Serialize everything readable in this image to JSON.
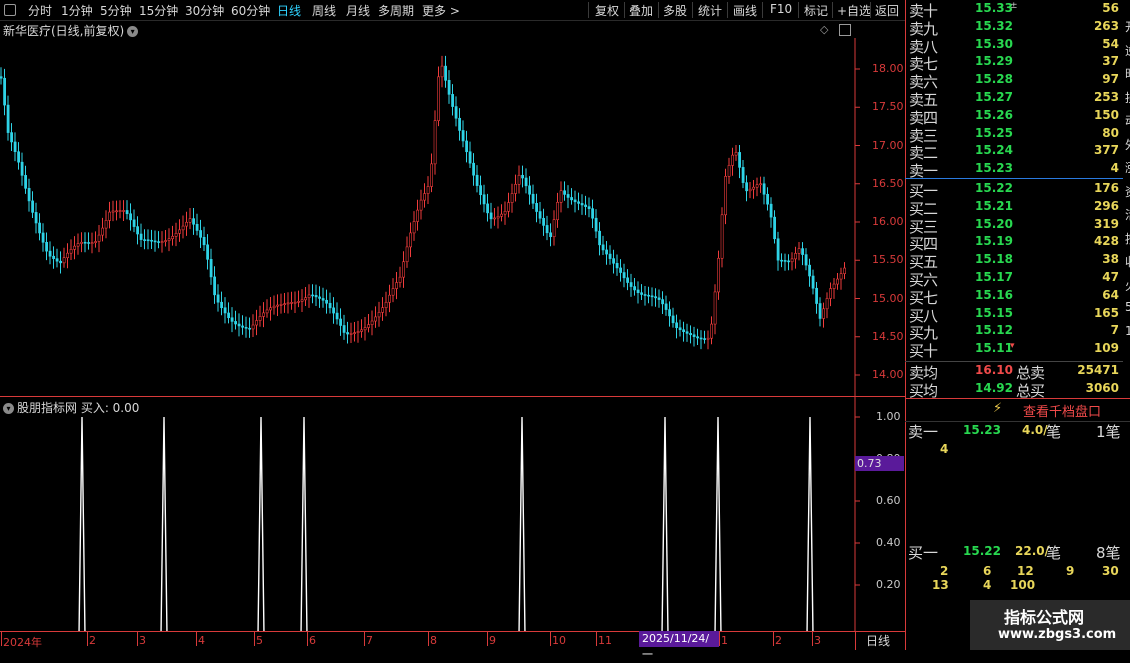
{
  "toolbar": {
    "periods": [
      "分时",
      "1分钟",
      "5分钟",
      "15分钟",
      "30分钟",
      "60分钟",
      "日线",
      "周线",
      "月线",
      "多周期",
      "更多 >"
    ],
    "active_period": "日线",
    "tools": [
      "复权",
      "叠加",
      "多股",
      "统计",
      "画线",
      "F10",
      "标记",
      "+自选",
      "返回"
    ]
  },
  "chart": {
    "stock_title": "新华医疗(日线,前复权)",
    "price_ticks": [
      "18.00",
      "17.50",
      "17.00",
      "16.50",
      "16.00",
      "15.50",
      "15.00",
      "14.50",
      "14.00"
    ],
    "indicator_title": "股朋指标网  买入: 0.00",
    "indicator_ticks": [
      "1.00",
      "0.80",
      "0.60",
      "0.40",
      "0.20"
    ],
    "cursor_value": "0.73",
    "dates": [
      "2024年",
      "2",
      "3",
      "4",
      "5",
      "6",
      "7",
      "8",
      "9",
      "10",
      "11",
      "1",
      "2",
      "3"
    ],
    "highlight_date": "2025/11/24/一",
    "period_button": "日线",
    "colors": {
      "up": "#f03c3c",
      "down": "#2fd3e6",
      "axis": "#d83a3a",
      "signal": "#ffffff"
    }
  },
  "orderbook": {
    "sells": [
      {
        "label": "卖十",
        "price": "15.33",
        "vol": "56",
        "flag": "±"
      },
      {
        "label": "卖九",
        "price": "15.32",
        "vol": "263"
      },
      {
        "label": "卖八",
        "price": "15.30",
        "vol": "54"
      },
      {
        "label": "卖七",
        "price": "15.29",
        "vol": "37"
      },
      {
        "label": "卖六",
        "price": "15.28",
        "vol": "97"
      },
      {
        "label": "卖五",
        "price": "15.27",
        "vol": "253"
      },
      {
        "label": "卖四",
        "price": "15.26",
        "vol": "150"
      },
      {
        "label": "卖三",
        "price": "15.25",
        "vol": "80"
      },
      {
        "label": "卖二",
        "price": "15.24",
        "vol": "377"
      },
      {
        "label": "卖一",
        "price": "15.23",
        "vol": "4"
      }
    ],
    "buys": [
      {
        "label": "买一",
        "price": "15.22",
        "vol": "176"
      },
      {
        "label": "买二",
        "price": "15.21",
        "vol": "296"
      },
      {
        "label": "买三",
        "price": "15.20",
        "vol": "319"
      },
      {
        "label": "买四",
        "price": "15.19",
        "vol": "428"
      },
      {
        "label": "买五",
        "price": "15.18",
        "vol": "38"
      },
      {
        "label": "买六",
        "price": "15.17",
        "vol": "47"
      },
      {
        "label": "买七",
        "price": "15.16",
        "vol": "64"
      },
      {
        "label": "买八",
        "price": "15.15",
        "vol": "165"
      },
      {
        "label": "买九",
        "price": "15.12",
        "vol": "7"
      },
      {
        "label": "买十",
        "price": "15.11",
        "vol": "109",
        "flag": "▾"
      }
    ],
    "sell_avg": {
      "label": "卖均",
      "price": "16.10",
      "total_label": "总卖",
      "total": "25471"
    },
    "buy_avg": {
      "label": "买均",
      "price": "14.92",
      "total_label": "总买",
      "total": "3060"
    },
    "qiandang_label": "查看千档盘口",
    "sell1_detail": {
      "label": "卖一",
      "price": "15.23",
      "per": "4.0/",
      "unit": "笔",
      "count": "1笔",
      "orders": [
        "4"
      ]
    },
    "buy1_detail": {
      "label": "买一",
      "price": "15.22",
      "per": "22.0/",
      "unit": "笔",
      "count": "8笔",
      "orders_row1": [
        "2",
        "6",
        "12",
        "9",
        "30"
      ],
      "orders_row2": [
        "13",
        "4",
        "100"
      ]
    },
    "side_chars": [
      "开",
      "逆",
      "时",
      "损",
      "动",
      "外",
      "涨",
      "资",
      "活",
      "按",
      "收",
      "火",
      "5",
      "1"
    ],
    "watermark_title": "指标公式网",
    "watermark_url": "www.zbgs3.com"
  }
}
